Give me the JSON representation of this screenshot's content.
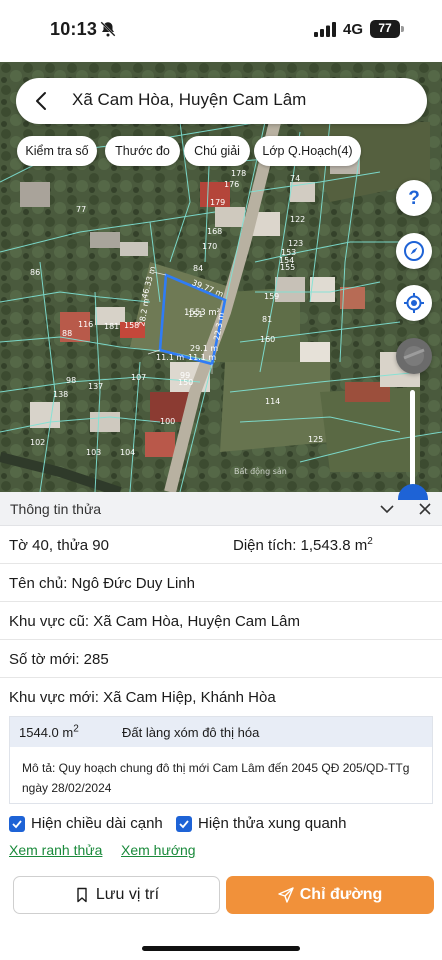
{
  "status_bar": {
    "time": "10:13",
    "network": "4G",
    "battery": "77"
  },
  "search": {
    "title": "Xã Cam Hòa, Huyện Cam Lâm"
  },
  "map_tools": [
    {
      "label": "Kiểm tra số"
    },
    {
      "label": "Thước đo"
    },
    {
      "label": "Chú giải"
    },
    {
      "label": "Lớp Q.Hoạch(4)"
    }
  ],
  "map": {
    "parcel_labels": [
      {
        "text": "77",
        "red": false
      },
      {
        "text": "86",
        "red": false
      },
      {
        "text": "88",
        "red": false
      },
      {
        "text": "98",
        "red": false
      },
      {
        "text": "137",
        "red": false
      },
      {
        "text": "107",
        "red": false
      },
      {
        "text": "138",
        "red": false
      },
      {
        "text": "102",
        "red": false
      },
      {
        "text": "103",
        "red": false
      },
      {
        "text": "104",
        "red": false
      },
      {
        "text": "100",
        "red": false
      },
      {
        "text": "99",
        "red": false
      },
      {
        "text": "150",
        "red": false
      },
      {
        "text": "84",
        "red": false
      },
      {
        "text": "170",
        "red": false
      },
      {
        "text": "168",
        "red": false
      },
      {
        "text": "179",
        "red": false
      },
      {
        "text": "176",
        "red": false
      },
      {
        "text": "178",
        "red": false
      },
      {
        "text": "74",
        "red": false
      },
      {
        "text": "122",
        "red": false
      },
      {
        "text": "123",
        "red": false
      },
      {
        "text": "153",
        "red": false
      },
      {
        "text": "154",
        "red": false
      },
      {
        "text": "155",
        "red": false
      },
      {
        "text": "159",
        "red": false
      },
      {
        "text": "81",
        "red": false
      },
      {
        "text": "160",
        "red": false
      },
      {
        "text": "114",
        "red": false
      },
      {
        "text": "125",
        "red": false
      },
      {
        "text": "151",
        "red": false
      },
      {
        "text": "116",
        "red": false
      },
      {
        "text": "181",
        "red": false
      },
      {
        "text": "158",
        "red": false
      }
    ],
    "area_label": "1553 m²",
    "dimension_labels": [
      "39.77 m",
      "22.3 m",
      "46.33 m",
      "28.2 m",
      "11.1 m",
      "11.1 m",
      "29.1 m"
    ],
    "watermark": "Bất động sản"
  },
  "panel": {
    "title": "Thông tin thửa",
    "sheet_parcel": "Tờ 40, thửa 90",
    "area_label": "Diện tích: 1,543.8 m",
    "area_unit_sup": "2",
    "owner": "Tên chủ: Ngô Đức Duy Linh",
    "old_region": "Khu vực cũ: Xã Cam Hòa, Huyện Cam Lâm",
    "new_sheet": "Số tờ mới: 285",
    "new_region": "Khu vực mới: Xã Cam Hiệp, Khánh Hòa",
    "plan": {
      "area": "1544.0 m",
      "area_sup": "2",
      "land_type": "Đất làng xóm đô thị hóa",
      "description": "Mô tả: Quy hoạch chung đô thị mới Cam Lâm đến 2045 QĐ 205/QD-TTg ngày 28/02/2024"
    },
    "options": {
      "show_edge_length": "Hiện chiều dài cạnh",
      "show_neighbors": "Hiện thửa xung quanh",
      "show_edge_length_checked": true,
      "show_neighbors_checked": true
    },
    "links": {
      "boundary": "Xem ranh thửa",
      "direction": "Xem hướng"
    },
    "buttons": {
      "save": "Lưu vị trí",
      "route": "Chỉ đường"
    }
  },
  "colors": {
    "accent_blue": "#1e63d6",
    "route_orange": "#f1913a",
    "link_green": "#1a8a3b",
    "parcel_line": "#7fe3d6",
    "selected_parcel": "#2f7cf6"
  }
}
